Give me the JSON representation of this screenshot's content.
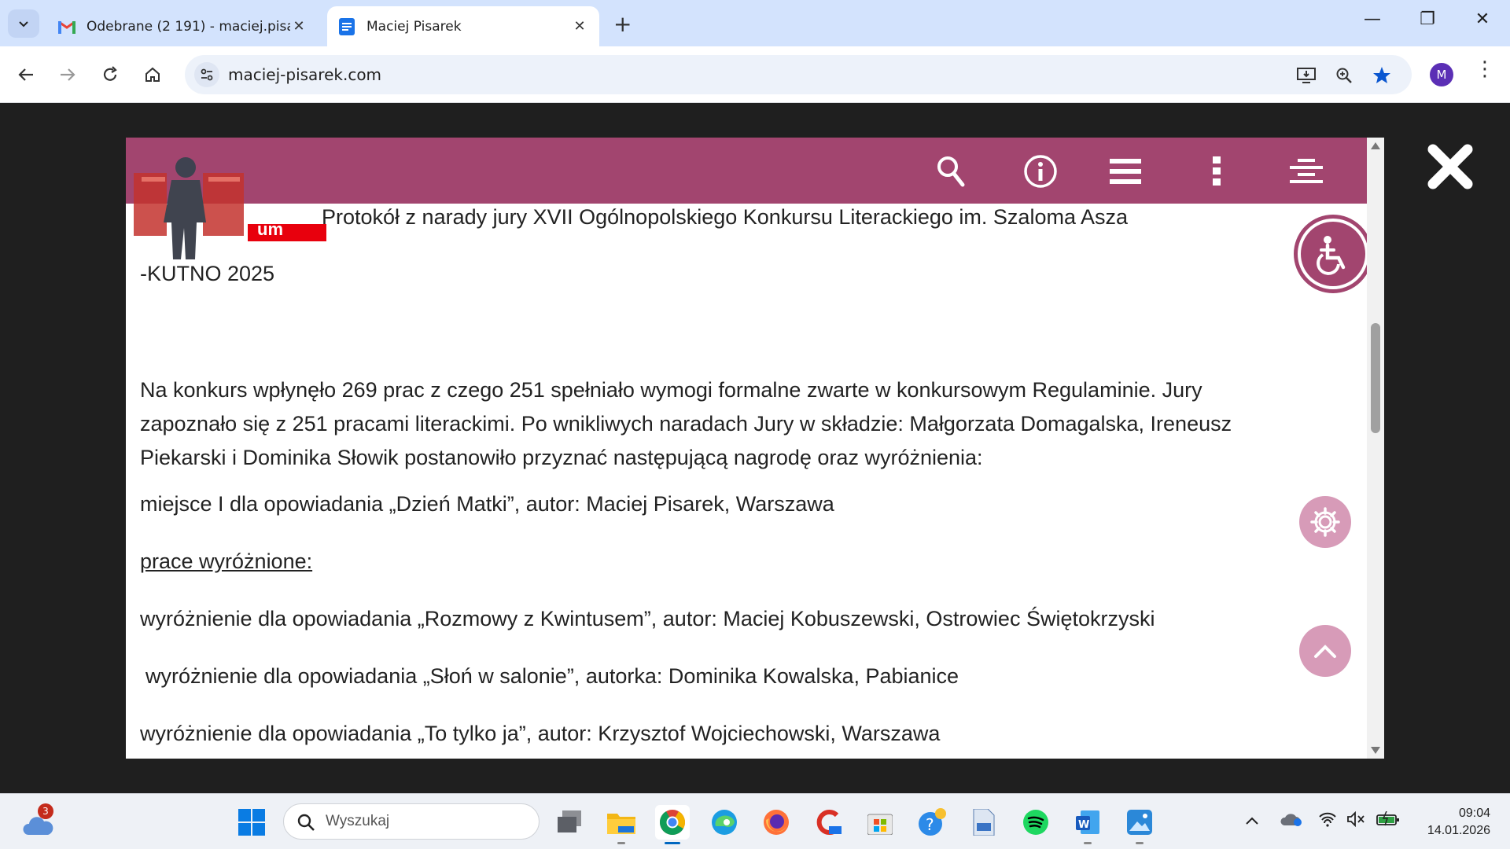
{
  "browser": {
    "tabs": [
      {
        "title": "Odebrane (2 191) - maciej.pisar",
        "icon": "gmail-icon",
        "active": false
      },
      {
        "title": "Maciej Pisarek",
        "icon": "docs-icon",
        "active": true
      }
    ],
    "new_tab_label": "+",
    "url": "maciej-pisarek.com",
    "profile_initial": "M"
  },
  "page": {
    "logo_text": "um",
    "title_line1": "Protokół z narady jury XVII Ogólnopolskiego Konkursu Literackiego im. Szaloma Asza",
    "title_line2": "-KUTNO 2025",
    "paragraph": "Na konkurs wpłynęło 269 prac z czego 251 spełniało wymogi formalne zwarte w konkursowym Regulaminie. Jury zapoznało się z 251 pracami literackimi. Po wnikliwych naradach Jury w składzie: Małgorzata Domagalska, Ireneusz Piekarski i Dominika Słowik postanowiło przyznać następującą nagrodę oraz wyróżnienia:",
    "award_first": "miejsce I dla opowiadania „Dzień Matki”, autor: Maciej Pisarek, Warszawa",
    "distinctions_heading": "prace wyróżnione:",
    "distinctions": [
      "wyróżnienie dla  opowiadania  „Rozmowy z Kwintusem”, autor: Maciej Kobuszewski, Ostrowiec Świętokrzyski",
      " wyróżnienie dla opowiadania „Słoń w salonie”, autorka: Dominika Kowalska, Pabianice",
      "wyróżnienie dla opowiadania „To tylko ja”, autor: Krzysztof Wojciechowski, Warszawa"
    ],
    "colors": {
      "header": "#a2456f",
      "floating_btn": "#d79bb8",
      "logo_red": "#e8000d"
    }
  },
  "taskbar": {
    "search_placeholder": "Wyszukaj",
    "weather_badge": "3",
    "time": "09:04",
    "date": "14.01.2026"
  }
}
